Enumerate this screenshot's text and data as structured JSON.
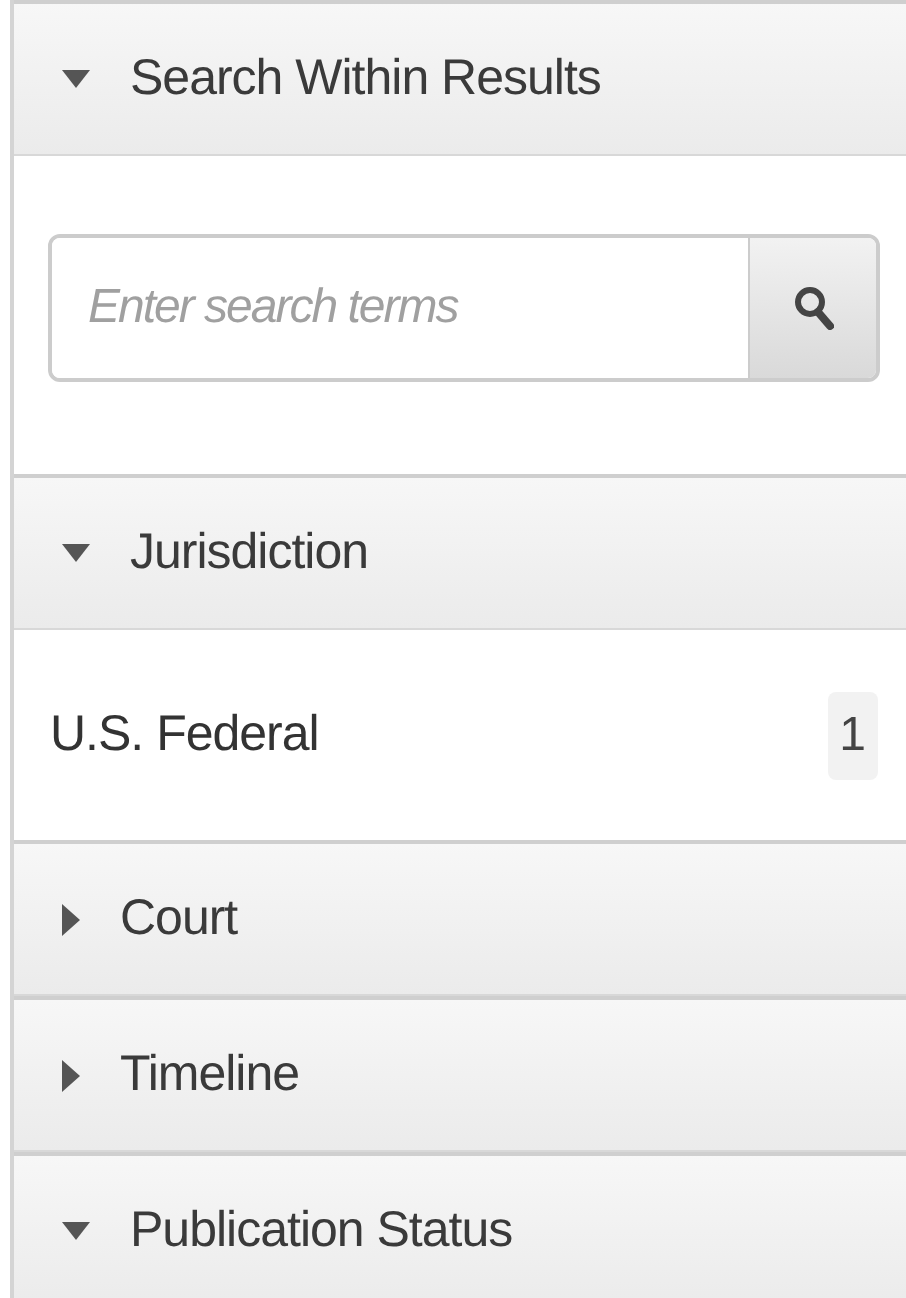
{
  "sections": [
    {
      "title": "Search Within Results",
      "expanded": true,
      "kind": "search",
      "search": {
        "placeholder": "Enter search terms"
      }
    },
    {
      "title": "Jurisdiction",
      "expanded": true,
      "kind": "facets",
      "items": [
        {
          "label": "U.S. Federal",
          "count": "1"
        }
      ]
    },
    {
      "title": "Court",
      "expanded": false
    },
    {
      "title": "Timeline",
      "expanded": false
    },
    {
      "title": "Publication Status",
      "expanded": true
    }
  ]
}
